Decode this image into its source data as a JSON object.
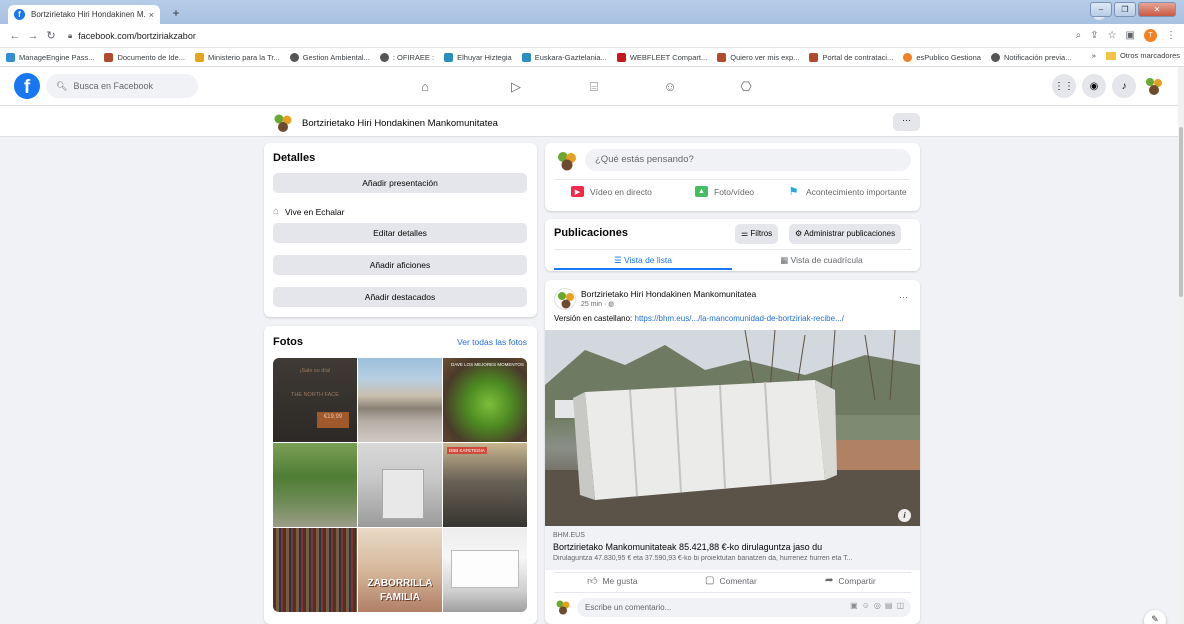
{
  "browser": {
    "tab_title": "Bortzirietako Hiri Hondakinen M...",
    "tab_close": "×",
    "new_tab": "+",
    "url": "facebook.com/bortziriakzabor",
    "bookmarks": [
      {
        "label": "ManageEngine Pass...",
        "color": "#2f8fd8"
      },
      {
        "label": "Documento de Ide...",
        "color": "#b24a2f"
      },
      {
        "label": "Ministerio para la Tr...",
        "color": "#e3a51c"
      },
      {
        "label": "Gestion Ambiental...",
        "color": "#555555"
      },
      {
        "label": ": OFIRAEE :",
        "color": "#555555"
      },
      {
        "label": "Elhuyar Hiztegia",
        "color": "#2a8fbf"
      },
      {
        "label": "Euskara-Gaztelania...",
        "color": "#2a8fbf"
      },
      {
        "label": "WEBFLEET Compart...",
        "color": "#c4161c"
      },
      {
        "label": "Quiero ver mis exp...",
        "color": "#b24a2f"
      },
      {
        "label": "Portal de contrataci...",
        "color": "#b24a2f"
      },
      {
        "label": "esPublico Gestiona",
        "color": "#f4801f"
      },
      {
        "label": "Notificación previa...",
        "color": "#555555"
      }
    ],
    "bookmarks_overflow": "»",
    "other_bookmarks": "Otros marcadores",
    "profile_initial": "T"
  },
  "fb": {
    "logo_letter": "f",
    "search_placeholder": "Busca en Facebook",
    "page_name": "Bortzirietako Hiri Hondakinen Mankomunitatea",
    "more": "···"
  },
  "detalles": {
    "title": "Detalles",
    "add_presentation": "Añadir presentación",
    "lives_in": "Vive en Echalar",
    "edit_details": "Editar detalles",
    "add_hobbies": "Añadir aficiones",
    "add_featured": "Añadir destacados"
  },
  "fotos": {
    "title": "Fotos",
    "see_all": "Ver todas las fotos",
    "photo1_lines": [
      "¡Sale su día!",
      "THE NORTH FACE"
    ],
    "photo1_price": "€19,99",
    "photo3_text": "DAVE LOS MEJORES MOMENTOS",
    "photo6_text": "DBB KAFETEGIA",
    "photo8_lines": [
      "ZABORRILLA",
      "FAMILIA"
    ]
  },
  "composer": {
    "placeholder": "¿Qué estás pensando?",
    "live_video": "Vídeo en directo",
    "photo_video": "Foto/vídeo",
    "life_event": "Acontecimiento importante"
  },
  "publicaciones": {
    "title": "Publicaciones",
    "filters": "Filtros",
    "manage": "Administrar publicaciones",
    "list_view": "Vista de lista",
    "grid_view": "Vista de cuadrícula"
  },
  "post": {
    "author": "Bortzirietako Hiri Hondakinen Mankomunitatea",
    "time": "25 min ·",
    "more": "···",
    "text_prefix": "Versión en castellano: ",
    "text_link": "https://bhm.eus/.../la-mancomunidad-de-bortziriak-recibe.../",
    "link_domain": "BHM.EUS",
    "link_title": "Bortzirietako Mankomunitateak 85.421,88 €-ko dirulaguntza jaso du",
    "link_desc": "Dirulaguntza 47.830,95 € eta 37.590,93 €-ko bi proiektutan banatzen da, hurrenez hurren eta T...",
    "like": "Me gusta",
    "comment": "Comentar",
    "share": "Compartir",
    "comment_placeholder": "Escribe un comentario..."
  },
  "colors": {
    "facebook_blue": "#1877f2",
    "link_blue": "#216fdb",
    "background": "#f0f2f5",
    "button_gray": "#e4e6eb"
  }
}
